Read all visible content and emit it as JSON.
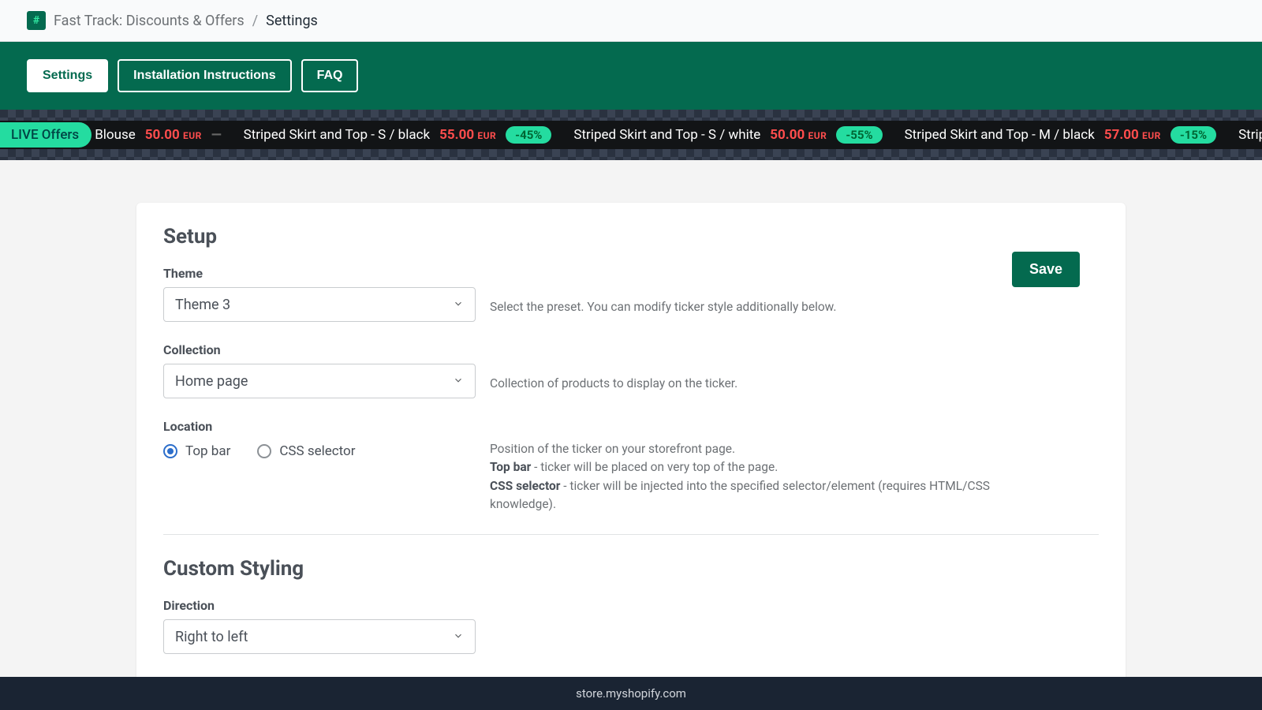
{
  "breadcrumb": {
    "app_name": "Fast Track: Discounts & Offers",
    "current": "Settings"
  },
  "tabs": {
    "settings": "Settings",
    "install": "Installation Instructions",
    "faq": "FAQ"
  },
  "ticker": {
    "live_label": "LIVE Offers",
    "items": [
      {
        "name": "Blouse",
        "price": "50.00",
        "currency": "EUR",
        "badge": "—"
      },
      {
        "name": "Striped Skirt and Top - S / black",
        "price": "55.00",
        "currency": "EUR",
        "badge": "-45%"
      },
      {
        "name": "Striped Skirt and Top - S / white",
        "price": "50.00",
        "currency": "EUR",
        "badge": "-55%"
      },
      {
        "name": "Striped Skirt and Top - M / black",
        "price": "57.00",
        "currency": "EUR",
        "badge": "-15%"
      },
      {
        "name": "Striped Skirt and Top - M /",
        "price": "",
        "currency": "",
        "badge": ""
      }
    ]
  },
  "form": {
    "setup_heading": "Setup",
    "theme_label": "Theme",
    "theme_value": "Theme 3",
    "theme_hint": "Select the preset. You can modify ticker style additionally below.",
    "collection_label": "Collection",
    "collection_value": "Home page",
    "collection_hint": "Collection of products to display on the ticker.",
    "location_label": "Location",
    "location_options": {
      "topbar": "Top bar",
      "css": "CSS selector"
    },
    "location_hint_intro": "Position of the ticker on your storefront page.",
    "location_hint_topbar_key": "Top bar",
    "location_hint_topbar_text": " - ticker will be placed on very top of the page.",
    "location_hint_css_key": "CSS selector",
    "location_hint_css_text": " - ticker will be injected into the specified selector/element (requires HTML/CSS knowledge).",
    "custom_heading": "Custom Styling",
    "direction_label": "Direction",
    "direction_value": "Right to left",
    "save": "Save"
  },
  "footer": {
    "domain": "store.myshopify.com"
  }
}
